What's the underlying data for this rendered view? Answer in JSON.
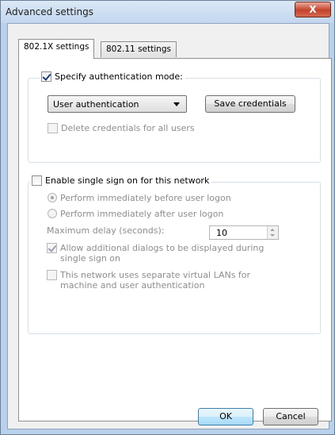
{
  "window": {
    "title": "Advanced settings",
    "close_glyph": "X"
  },
  "tabs": [
    {
      "label": "802.1X settings",
      "active": true
    },
    {
      "label": "802.11 settings",
      "active": false
    }
  ],
  "auth_group": {
    "specify_auth_label": "Specify authentication mode:",
    "specify_auth_checked": true,
    "auth_mode_selected": "User authentication",
    "save_credentials_label": "Save credentials",
    "delete_credentials_label": "Delete credentials for all users",
    "delete_credentials_checked": false
  },
  "sso_group": {
    "enable_sso_label": "Enable single sign on for this network",
    "enable_sso_checked": false,
    "perform_before_label": "Perform immediately before user logon",
    "perform_before_selected": true,
    "perform_after_label": "Perform immediately after user logon",
    "perform_after_selected": false,
    "max_delay_label": "Maximum delay (seconds):",
    "max_delay_value": "10",
    "allow_dialogs_label": "Allow additional dialogs to be displayed during single sign on",
    "allow_dialogs_checked": true,
    "separate_vlans_label": "This network uses separate virtual LANs for machine and user authentication",
    "separate_vlans_checked": false
  },
  "footer": {
    "ok_label": "OK",
    "cancel_label": "Cancel"
  }
}
